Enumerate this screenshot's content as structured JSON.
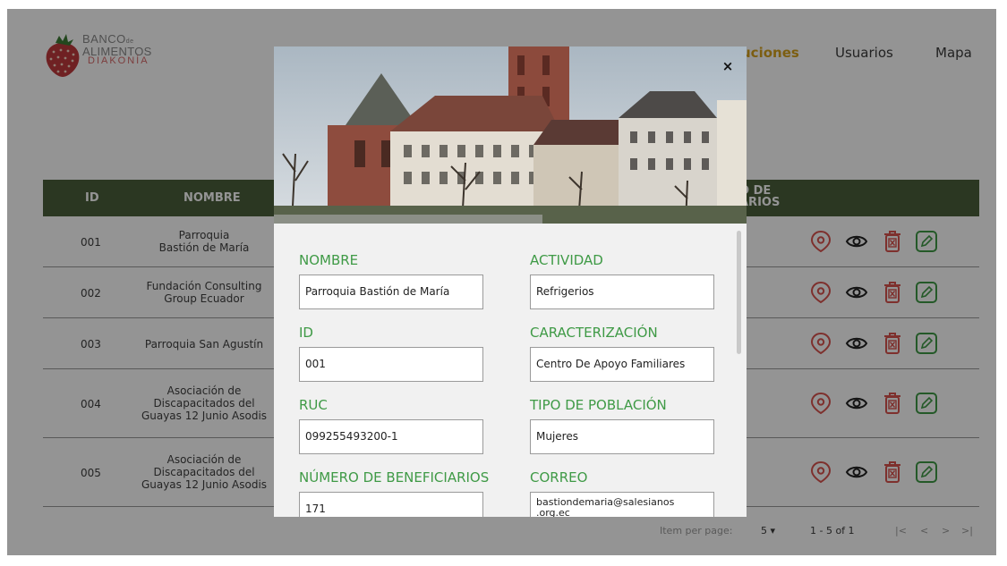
{
  "logo": {
    "line1": "BANCO",
    "line1_small": "de",
    "line2": "ALIMENTOS",
    "line3": "DIAKONÍA"
  },
  "nav": {
    "instituciones": "uciones",
    "usuarios": "Usuarios",
    "mapa": "Mapa"
  },
  "table": {
    "headers": {
      "id": "ID",
      "nombre": "NOMBRE",
      "beneficiarios_1": "O DE",
      "beneficiarios_2": "ARIOS"
    },
    "rows": [
      {
        "id": "001",
        "name": [
          "Parroquia",
          "Bastión de María"
        ]
      },
      {
        "id": "002",
        "name": [
          "Fundación Consulting",
          "Group Ecuador"
        ]
      },
      {
        "id": "003",
        "name": [
          "Parroquia San Agustín"
        ]
      },
      {
        "id": "004",
        "name": [
          "Asociación de",
          "Discapacitados del",
          "Guayas 12 Junio Asodis"
        ]
      },
      {
        "id": "005",
        "name": [
          "Asociación de",
          "Discapacitados del",
          "Guayas 12 Junio Asodis"
        ]
      }
    ],
    "row_icons": [
      "map-pin-icon",
      "eye-icon",
      "delete-icon",
      "edit-icon"
    ]
  },
  "pagination": {
    "items_label": "Item per page:",
    "per_page": "5",
    "range": "1 - 5 of 1",
    "first": "|<",
    "prev": "<",
    "next": ">",
    "last": ">|"
  },
  "modal": {
    "close": "×",
    "fields": {
      "nombre": {
        "label": "NOMBRE",
        "value": "Parroquia Bastión de María"
      },
      "actividad": {
        "label": "ACTIVIDAD",
        "value": "Refrigerios"
      },
      "id": {
        "label": "ID",
        "value": "001"
      },
      "caracterizacion": {
        "label": "CARACTERIZACIÓN",
        "value": "Centro De Apoyo Familiares"
      },
      "ruc": {
        "label": "RUC",
        "value": "099255493200-1"
      },
      "tipo_poblacion": {
        "label": "TIPO DE POBLACIÓN",
        "value": "Mujeres"
      },
      "beneficiarios": {
        "label": "NÚMERO DE BENEFICIARIOS",
        "value": "171"
      },
      "correo": {
        "label": "CORREO",
        "value": "bastiondemaria@salesianos .org.ec"
      }
    }
  },
  "colors": {
    "header_bg": "#4a5f3c",
    "label_green": "#3f9a46",
    "nav_active": "#d6a21e",
    "icon_red": "#d9534f",
    "icon_green": "#3f9a46"
  }
}
